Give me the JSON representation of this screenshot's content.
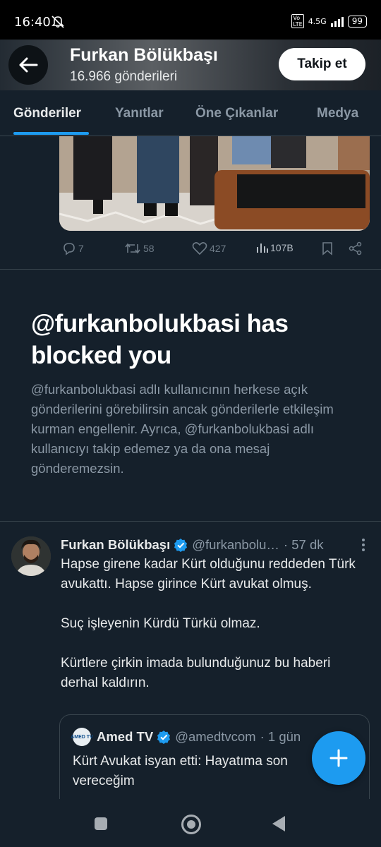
{
  "status_bar": {
    "time": "16:40",
    "network": "4.5G",
    "battery": "99",
    "icons": [
      "mute-icon",
      "volte-icon",
      "signal-icon",
      "battery-icon"
    ]
  },
  "profile_header": {
    "name": "Furkan Bölükbaşı",
    "posts_count": "16.966 gönderileri",
    "follow_label": "Takip et"
  },
  "tabs": [
    {
      "label": "Gönderiler",
      "active": true
    },
    {
      "label": "Yanıtlar",
      "active": false
    },
    {
      "label": "Öne Çıkanlar",
      "active": false
    },
    {
      "label": "Medya",
      "active": false
    }
  ],
  "prev_tweet_actions": {
    "replies": "7",
    "retweets": "58",
    "likes": "427",
    "views": "107B"
  },
  "blocked_notice": {
    "title": "@furkanbolukbasi has blocked you",
    "description": "@furkanbolukbasi adlı kullanıcının herkese açık gönderilerini görebilirsin ancak gönderilerle etkileşim kurman engellenir. Ayrıca, @furkanbolukbasi adlı kullanıcıyı takip edemez ya da ona mesaj gönderemezsin."
  },
  "tweet": {
    "author": "Furkan Bölükbaşı",
    "handle": "@furkanbolu…",
    "time": "· 57 dk",
    "lines": [
      "Hapse girene kadar Kürt olduğunu reddeden Türk avukattı. Hapse girince Kürt avukat olmuş.",
      "Suç işleyenin Kürdü Türkü olmaz.",
      "Kürtlere çirkin imada bulunduğunuz bu haberi derhal kaldırın."
    ]
  },
  "quoted_tweet": {
    "logo_text": "AMED TV",
    "author": "Amed TV",
    "handle": "@amedtvcom",
    "time": "· 1 gün",
    "text": "Kürt Avukat isyan etti: Hayatıma son vereceğim"
  },
  "colors": {
    "background": "#15202b",
    "accent": "#1d9bf0",
    "muted": "#8b98a5",
    "border": "#38444d"
  }
}
